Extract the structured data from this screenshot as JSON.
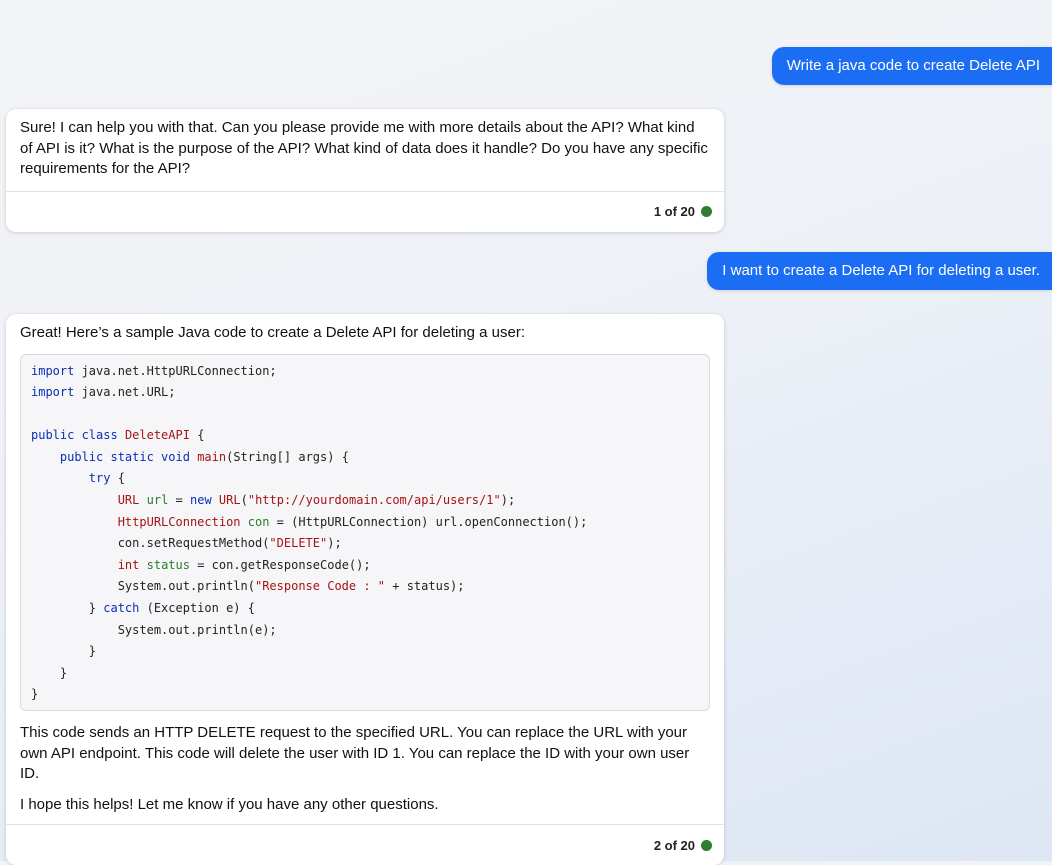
{
  "messages": {
    "user1": {
      "text": "Write a java code to create Delete API"
    },
    "bot1": {
      "text": "Sure! I can help you with that. Can you please provide me with more details about the API? What kind of API is it? What is the purpose of the API? What kind of data does it handle? Do you have any specific requirements for the API?",
      "counter": "1 of 20"
    },
    "user2": {
      "text": "I want to create a Delete API for deleting a user."
    },
    "bot2": {
      "intro": "Great! Here’s a sample Java code to create a Delete API for deleting a user:",
      "code": {
        "language": "java",
        "lines": [
          "import java.net.HttpURLConnection;",
          "import java.net.URL;",
          "",
          "public class DeleteAPI {",
          "    public static void main(String[] args) {",
          "        try {",
          "            URL url = new URL(\"http://yourdomain.com/api/users/1\");",
          "            HttpURLConnection con = (HttpURLConnection) url.openConnection();",
          "            con.setRequestMethod(\"DELETE\");",
          "            int status = con.getResponseCode();",
          "            System.out.println(\"Response Code : \" + status);",
          "        } catch (Exception e) {",
          "            System.out.println(e);",
          "        }",
          "    }",
          "}"
        ]
      },
      "explanation": "This code sends an HTTP DELETE request to the specified URL. You can replace the URL with your own API endpoint. This code will delete the user with ID 1. You can replace the ID with your own user ID.",
      "closing": "I hope this helps! Let me know if you have any other questions.",
      "counter": "2 of 20"
    }
  },
  "colors": {
    "user_bubble": "#1b6ef3",
    "status_dot": "#2e7d32",
    "keyword": "#0a2fb4",
    "type": "#a31515",
    "string": "#a31515",
    "variable": "#2a7d2a"
  },
  "icons": {
    "status": "green-dot-icon"
  }
}
